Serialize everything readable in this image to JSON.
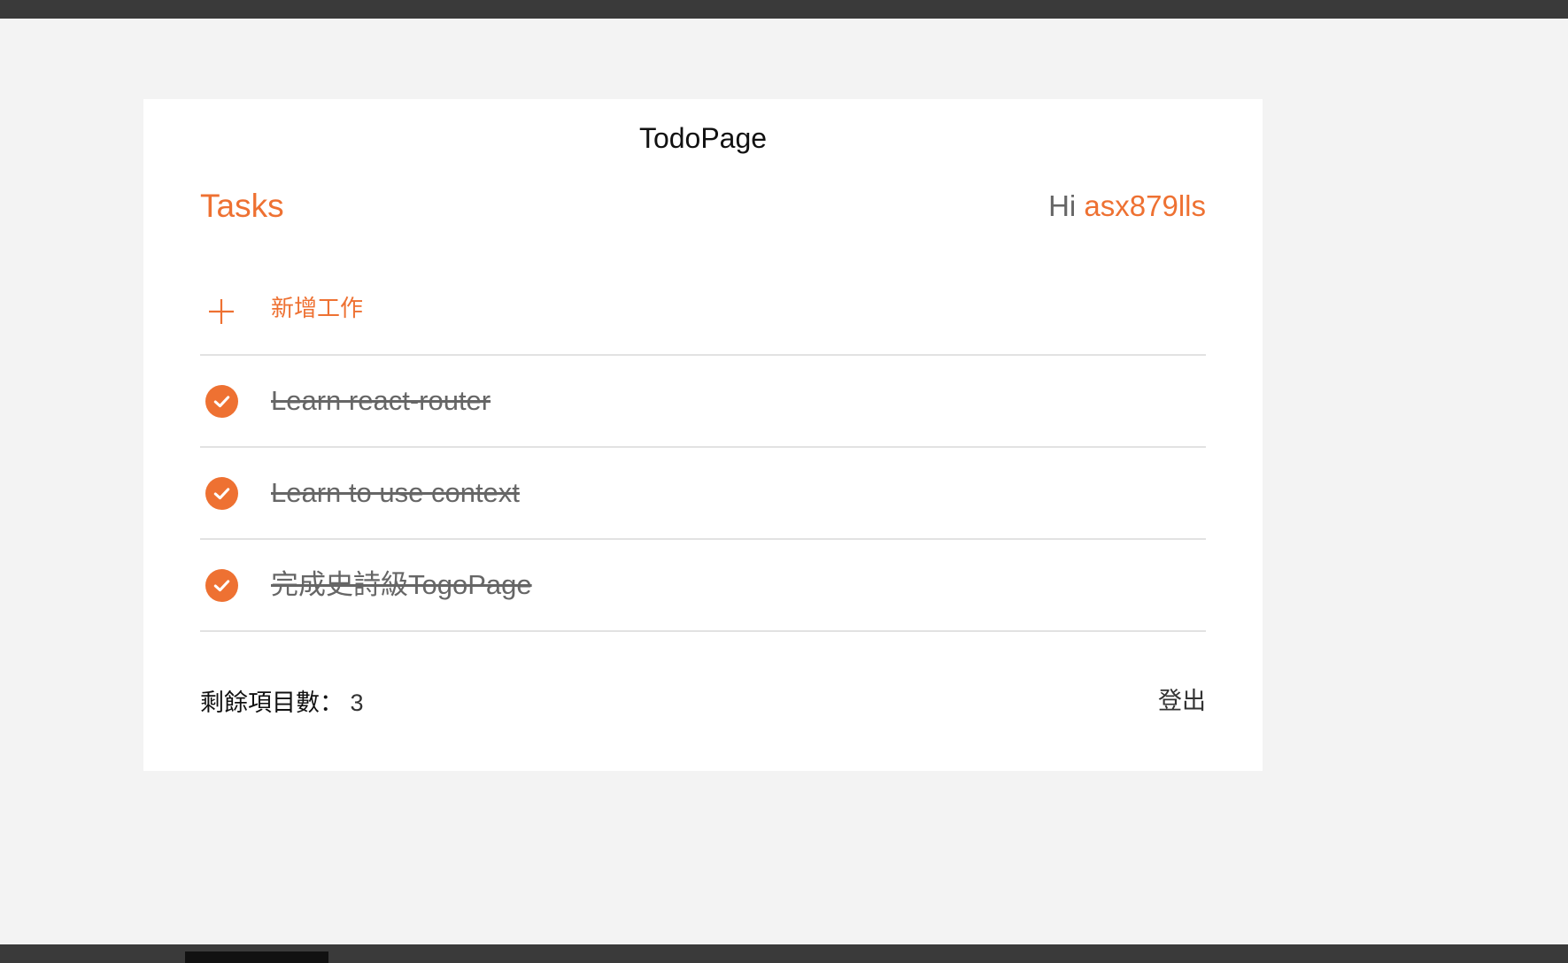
{
  "page_title": "TodoPage",
  "header": {
    "tasks_title": "Tasks",
    "greeting_prefix": "Hi",
    "username": "asx879lls"
  },
  "add_task": {
    "label": "新增工作",
    "icon": "plus-icon"
  },
  "tasks": [
    {
      "text": "Learn react-router",
      "completed": true,
      "icon": "check-circle-icon"
    },
    {
      "text": "Learn to use context",
      "completed": true,
      "icon": "check-circle-icon"
    },
    {
      "text": "完成史詩級TogoPage",
      "completed": true,
      "icon": "check-circle-icon"
    }
  ],
  "footer": {
    "remaining_label": "剩餘項目數：",
    "remaining_count": "3",
    "logout_label": "登出"
  },
  "colors": {
    "accent": "#ee7132",
    "background": "#f3f3f3",
    "card": "#ffffff",
    "muted_text": "#666666",
    "divider": "#e2e2e2"
  }
}
